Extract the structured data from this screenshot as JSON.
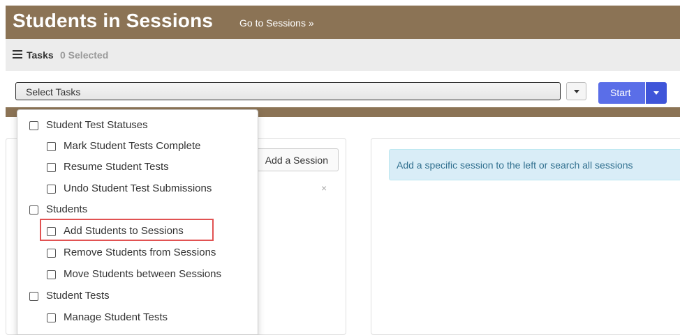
{
  "header": {
    "title": "Students in Sessions",
    "goto_link": "Go to Sessions »"
  },
  "tasks": {
    "label": "Tasks",
    "selected": "0 Selected",
    "select_value": "Select Tasks",
    "start_label": "Start"
  },
  "dropdown": {
    "group1": {
      "label": "Student Test Statuses",
      "items": [
        "Mark Student Tests Complete",
        "Resume Student Tests",
        "Undo Student Test Submissions"
      ]
    },
    "group2": {
      "label": "Students",
      "items": [
        "Add Students to Sessions",
        "Remove Students from Sessions",
        "Move Students between Sessions"
      ]
    },
    "group3": {
      "label": "Student Tests",
      "items": [
        "Manage Student Tests"
      ]
    }
  },
  "left_panel": {
    "add_session": "Add a Session",
    "close": "×"
  },
  "right_panel": {
    "info": "Add a specific session to the left or search all sessions"
  },
  "colors": {
    "header_bg": "#8b7355",
    "primary": "#5a6ee8",
    "highlight": "#e15252",
    "info_bg": "#d9edf7"
  }
}
